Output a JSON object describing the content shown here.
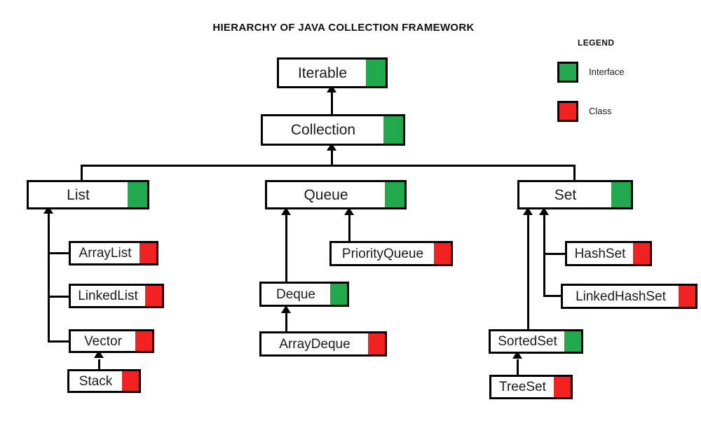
{
  "title": "HIERARCHY OF JAVA COLLECTION FRAMEWORK",
  "legend": {
    "title": "LEGEND",
    "items": [
      {
        "label": "Interface",
        "kind": "interface",
        "color": "#22a94e"
      },
      {
        "label": "Class",
        "kind": "class",
        "color": "#f22222"
      }
    ]
  },
  "colors": {
    "interface": "#22a94e",
    "class": "#f22222",
    "stroke": "#000000",
    "background": "#ffffff"
  },
  "nodes": {
    "iterable": {
      "label": "Iterable",
      "kind": "interface"
    },
    "collection": {
      "label": "Collection",
      "kind": "interface"
    },
    "list": {
      "label": "List",
      "kind": "interface"
    },
    "queue": {
      "label": "Queue",
      "kind": "interface"
    },
    "set": {
      "label": "Set",
      "kind": "interface"
    },
    "arraylist": {
      "label": "ArrayList",
      "kind": "class"
    },
    "linkedlist": {
      "label": "LinkedList",
      "kind": "class"
    },
    "vector": {
      "label": "Vector",
      "kind": "class"
    },
    "stack": {
      "label": "Stack",
      "kind": "class"
    },
    "priorityqueue": {
      "label": "PriorityQueue",
      "kind": "class"
    },
    "deque": {
      "label": "Deque",
      "kind": "interface"
    },
    "arraydeque": {
      "label": "ArrayDeque",
      "kind": "class"
    },
    "hashset": {
      "label": "HashSet",
      "kind": "class"
    },
    "linkedhashset": {
      "label": "LinkedHashSet",
      "kind": "class"
    },
    "sortedset": {
      "label": "SortedSet",
      "kind": "interface"
    },
    "treeset": {
      "label": "TreeSet",
      "kind": "class"
    }
  },
  "edges": [
    {
      "from": "collection",
      "to": "iterable"
    },
    {
      "from": "list",
      "to": "collection"
    },
    {
      "from": "queue",
      "to": "collection"
    },
    {
      "from": "set",
      "to": "collection"
    },
    {
      "from": "arraylist",
      "to": "list"
    },
    {
      "from": "linkedlist",
      "to": "list"
    },
    {
      "from": "vector",
      "to": "list"
    },
    {
      "from": "stack",
      "to": "vector"
    },
    {
      "from": "priorityqueue",
      "to": "queue"
    },
    {
      "from": "deque",
      "to": "queue"
    },
    {
      "from": "arraydeque",
      "to": "deque"
    },
    {
      "from": "hashset",
      "to": "set"
    },
    {
      "from": "linkedhashset",
      "to": "set"
    },
    {
      "from": "sortedset",
      "to": "set"
    },
    {
      "from": "treeset",
      "to": "sortedset"
    }
  ]
}
